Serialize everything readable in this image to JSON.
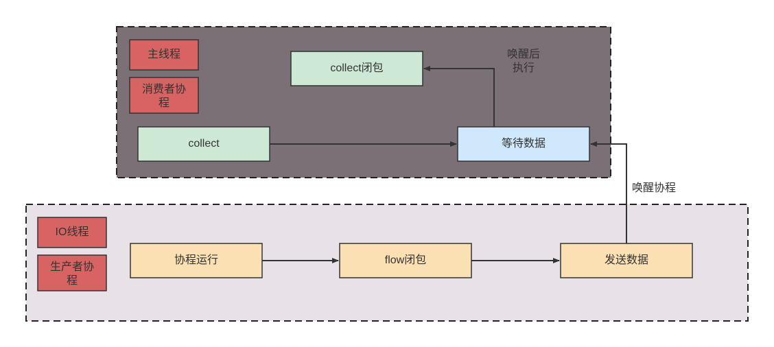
{
  "diagram": {
    "colors": {
      "top_container_fill": "#7b7076",
      "bottom_container_fill": "#e8e1e8",
      "red_box_fill": "#d76363",
      "red_box_stroke": "#333333",
      "green_box_fill": "#cee8d6",
      "green_box_stroke": "#333333",
      "blue_box_fill": "#cfe8fb",
      "blue_box_stroke": "#333333",
      "orange_box_fill": "#fbe0b3",
      "orange_box_stroke": "#333333",
      "dash_stroke": "#222222"
    },
    "top_container": {
      "tags": {
        "main_thread": "主线程",
        "consumer_coroutine_l1": "消费者协",
        "consumer_coroutine_l2": "程"
      },
      "boxes": {
        "collect": "collect",
        "collect_closure": "collect闭包",
        "wait_data": "等待数据"
      },
      "arrow_labels": {
        "wake_then_exec_l1": "唤醒后",
        "wake_then_exec_l2": "执行"
      }
    },
    "bottom_container": {
      "tags": {
        "io_thread": "IO线程",
        "producer_coroutine_l1": "生产者协",
        "producer_coroutine_l2": "程"
      },
      "boxes": {
        "coroutine_run": "协程运行",
        "flow_closure": "flow闭包",
        "send_data": "发送数据"
      }
    },
    "cross_labels": {
      "wake_coroutine": "唤醒协程"
    }
  }
}
